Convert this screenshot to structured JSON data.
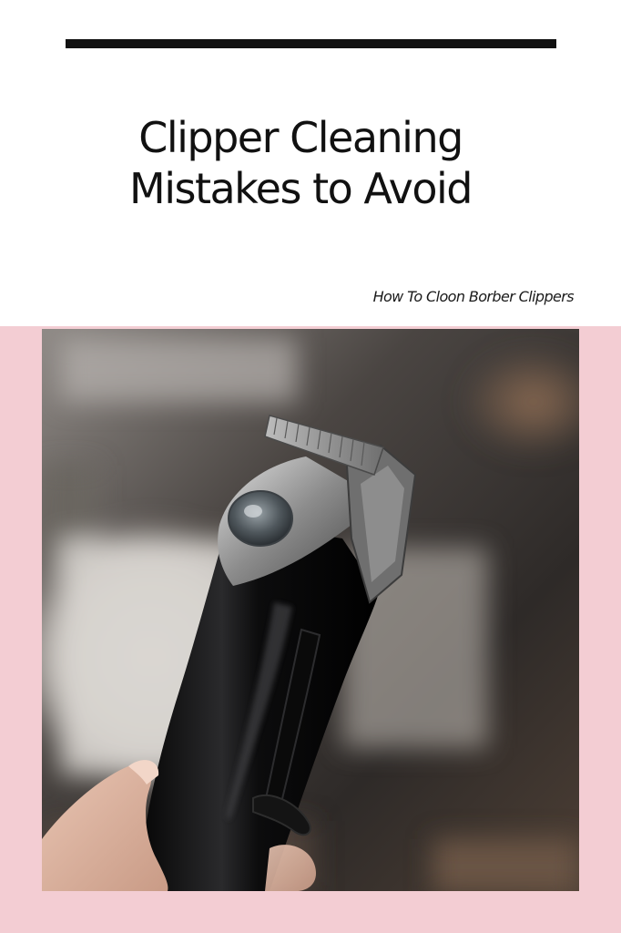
{
  "header": {
    "title_line_1": "Clipper Cleaning",
    "title_line_2": "Mistakes to Avoid",
    "subtitle": "How To Cloon Borber Clippers"
  },
  "colors": {
    "background": "#ffffff",
    "accent_bar": "#111111",
    "pink_panel": "#f3cdd3"
  },
  "photo": {
    "subject": "hair-clipper-in-hand-photo"
  }
}
